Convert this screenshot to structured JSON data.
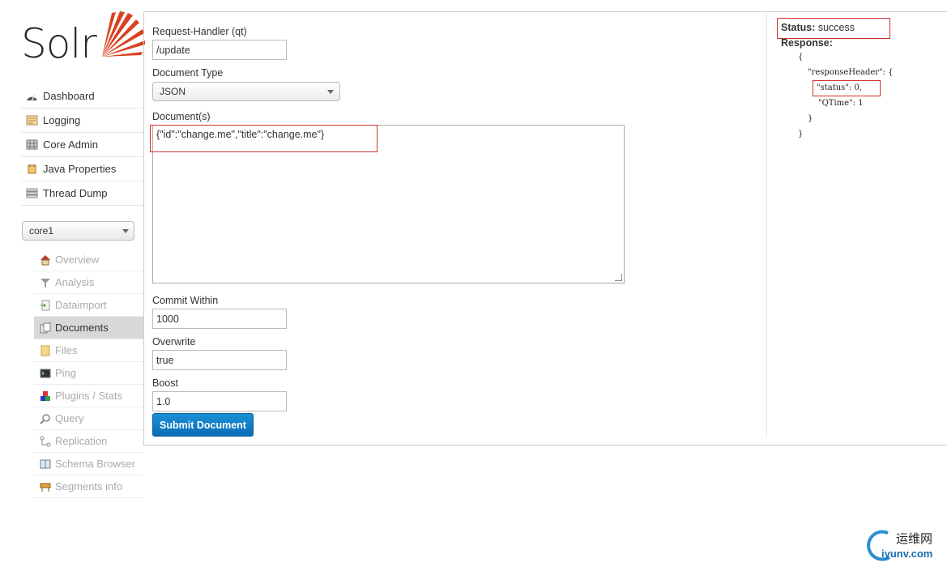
{
  "logo": {
    "text": "Solr"
  },
  "nav": {
    "items": [
      {
        "label": "Dashboard",
        "icon": "dashboard-icon"
      },
      {
        "label": "Logging",
        "icon": "logging-icon"
      },
      {
        "label": "Core Admin",
        "icon": "core-admin-icon"
      },
      {
        "label": "Java Properties",
        "icon": "java-properties-icon"
      },
      {
        "label": "Thread Dump",
        "icon": "thread-dump-icon"
      }
    ]
  },
  "core_selector": {
    "value": "core1"
  },
  "core_nav": {
    "items": [
      {
        "label": "Overview",
        "icon": "home-icon"
      },
      {
        "label": "Analysis",
        "icon": "funnel-icon"
      },
      {
        "label": "Dataimport",
        "icon": "import-icon"
      },
      {
        "label": "Documents",
        "icon": "documents-icon"
      },
      {
        "label": "Files",
        "icon": "folder-icon"
      },
      {
        "label": "Ping",
        "icon": "terminal-icon"
      },
      {
        "label": "Plugins / Stats",
        "icon": "plugins-icon"
      },
      {
        "label": "Query",
        "icon": "search-icon"
      },
      {
        "label": "Replication",
        "icon": "replication-icon"
      },
      {
        "label": "Schema Browser",
        "icon": "book-icon"
      },
      {
        "label": "Segments info",
        "icon": "barrier-icon"
      }
    ],
    "active": "Documents"
  },
  "form": {
    "request_handler_label": "Request-Handler (qt)",
    "request_handler_value": "/update",
    "document_type_label": "Document Type",
    "document_type_value": "JSON",
    "documents_label": "Document(s)",
    "documents_value": "{\"id\":\"change.me\",\"title\":\"change.me\"}",
    "commit_within_label": "Commit Within",
    "commit_within_value": "1000",
    "overwrite_label": "Overwrite",
    "overwrite_value": "true",
    "boost_label": "Boost",
    "boost_value": "1.0",
    "submit_label": "Submit Document"
  },
  "result": {
    "status_label": "Status:",
    "status_value": "success",
    "response_label": "Response:",
    "json_lines": [
      "{",
      "\"responseHeader\": {",
      "\"status\": 0,",
      "\"QTime\": 1",
      "}",
      "}"
    ]
  },
  "watermark": {
    "cn": "运维网",
    "en": "iyunv.com"
  },
  "colors": {
    "accent": "#0a6db6",
    "highlight": "#d0312d",
    "logo_red": "#d9411e"
  }
}
